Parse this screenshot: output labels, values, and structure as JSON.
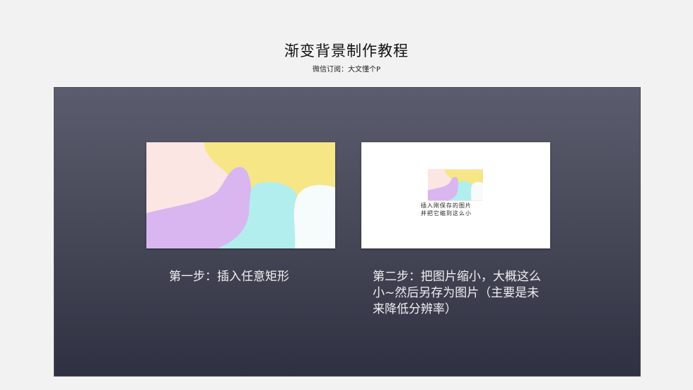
{
  "header": {
    "title": "渐变背景制作教程",
    "subtitle": "微信订阅：大文懂个P"
  },
  "steps": [
    {
      "caption": "第一步：插入任意矩形"
    },
    {
      "caption": "第二步：把图片缩小，大概这么小~然后另存为图片（主要是未来降低分辨率）",
      "thumb_text_1": "插入刚保存的图片",
      "thumb_text_2": "并把它缩到这么小"
    }
  ],
  "colors": {
    "pink": "#fce6e4",
    "yellow": "#f7e685",
    "purple": "#d9b6ef",
    "cyan": "#b2eeee",
    "white_blob": "#f6fbfc",
    "panel_top": "#5b5d6e",
    "panel_bottom": "#2f3142"
  }
}
